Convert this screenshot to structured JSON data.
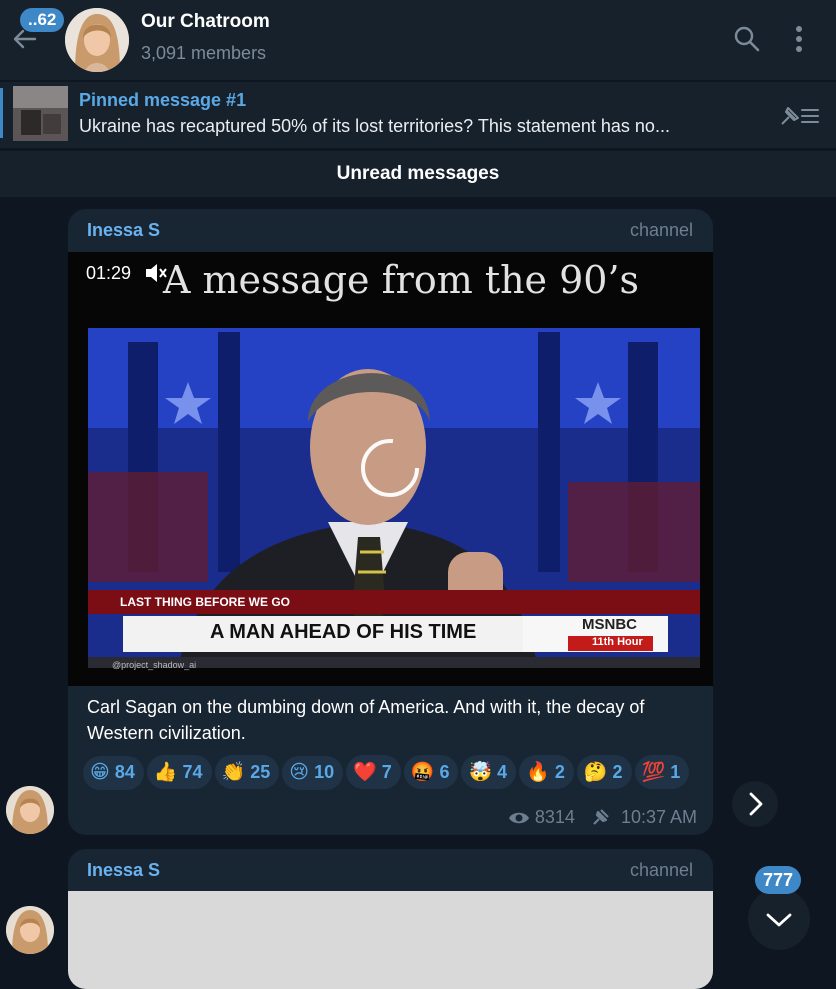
{
  "header": {
    "back_badge": "..62",
    "title": "Our Chatroom",
    "subtitle": "3,091 members",
    "icons": [
      "back-arrow-icon",
      "search-icon",
      "more-vertical-icon"
    ]
  },
  "pinned": {
    "title": "Pinned message #1",
    "text": "Ukraine has recaptured 50% of its lost territories? This statement has no...",
    "icon": "pin-list-icon"
  },
  "unread_label": "Unread messages",
  "messages": [
    {
      "sender": "Inessa S",
      "badge": "channel",
      "video": {
        "time": "01:29",
        "muted": true,
        "overlay_title": "A message from the 90’s",
        "lower_third_top": "LAST THING BEFORE WE GO",
        "lower_third_main": "A MAN AHEAD OF HIS TIME",
        "network": "MSNBC",
        "show": "11th Hour",
        "watermark": "@project_shadow_ai"
      },
      "caption": "Carl Sagan on the dumbing down of America. And with it, the decay of Western civilization.",
      "reactions": [
        {
          "emoji": "😁",
          "count": "84"
        },
        {
          "emoji": "👍",
          "count": "74"
        },
        {
          "emoji": "👏",
          "count": "25"
        },
        {
          "emoji": "😢",
          "count": "10"
        },
        {
          "emoji": "❤️",
          "count": "7"
        },
        {
          "emoji": "🤬",
          "count": "6"
        },
        {
          "emoji": "🤯",
          "count": "4"
        },
        {
          "emoji": "🔥",
          "count": "2"
        },
        {
          "emoji": "🤔",
          "count": "2"
        },
        {
          "emoji": "💯",
          "count": "1"
        }
      ],
      "views": "8314",
      "time": "10:37 AM"
    },
    {
      "sender": "Inessa S",
      "badge": "channel"
    }
  ],
  "scroll_badge": "777",
  "colors": {
    "background": "#0e1621",
    "panel": "#17212b",
    "bubble": "#182533",
    "accent": "#5aa9e6",
    "badge": "#3e88c8"
  }
}
